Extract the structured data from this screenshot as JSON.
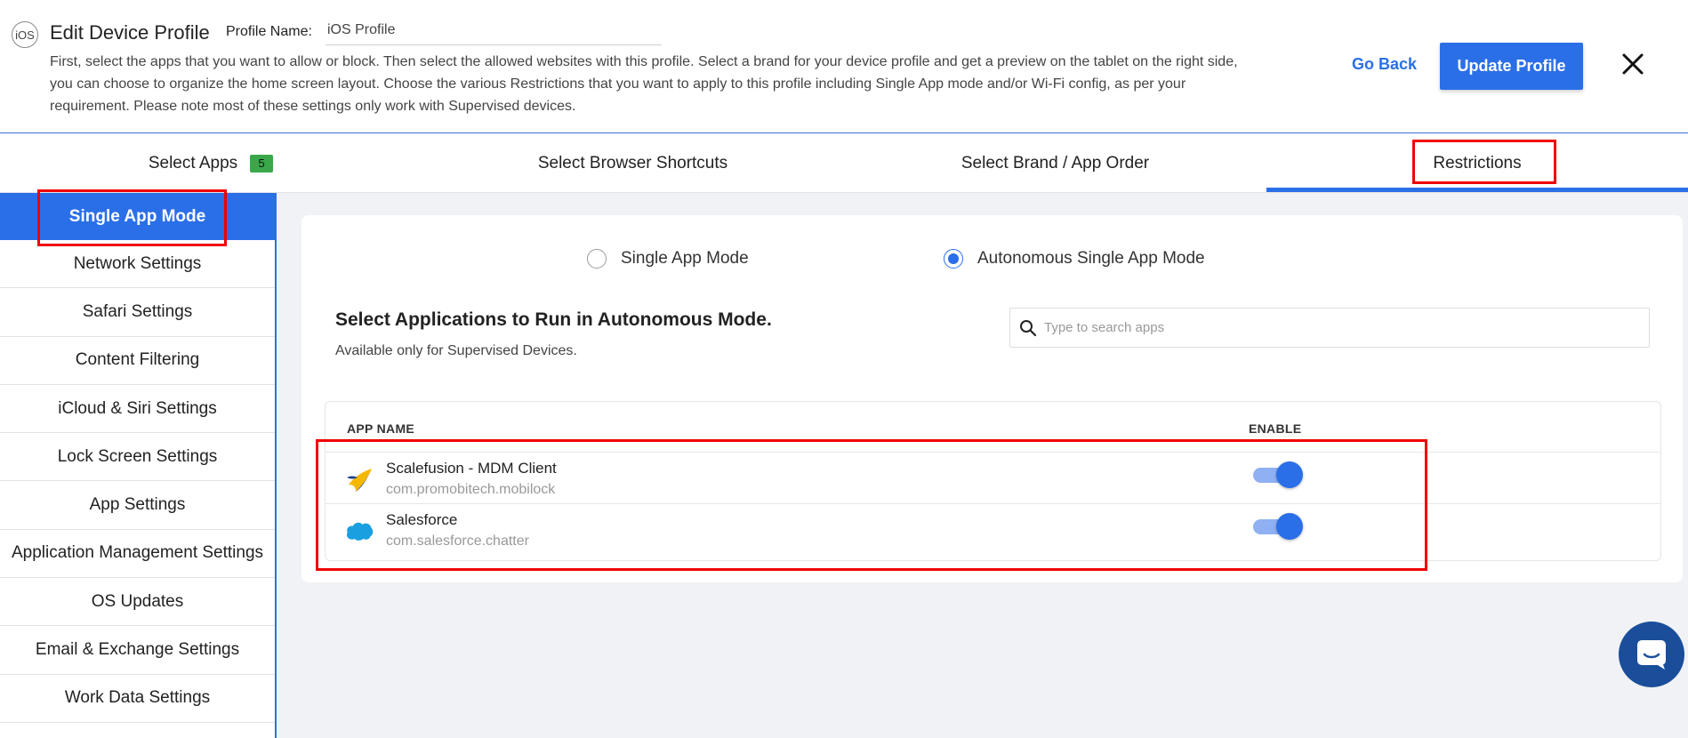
{
  "header": {
    "ios_label": "iOS",
    "title": "Edit Device Profile",
    "profile_name_label": "Profile Name:",
    "profile_name_value": "iOS Profile",
    "description": "First, select the apps that you want to allow or block. Then select the allowed websites with this profile. Select a brand for your device profile and get a preview on the tablet on the right side, you can choose to organize the home screen layout. Choose the various Restrictions that you want to apply to this profile including Single App mode and/or Wi-Fi config, as per your requirement. Please note most of these settings only work with Supervised devices.",
    "go_back": "Go Back",
    "update_profile": "Update Profile"
  },
  "tabs": [
    {
      "label": "Select Apps",
      "badge": "5"
    },
    {
      "label": "Select Browser Shortcuts"
    },
    {
      "label": "Select Brand / App Order"
    },
    {
      "label": "Restrictions",
      "active": true
    }
  ],
  "sidebar": {
    "items": [
      {
        "label": "Single App Mode",
        "active": true
      },
      {
        "label": "Network Settings"
      },
      {
        "label": "Safari Settings"
      },
      {
        "label": "Content Filtering"
      },
      {
        "label": "iCloud & Siri Settings"
      },
      {
        "label": "Lock Screen Settings"
      },
      {
        "label": "App Settings"
      },
      {
        "label": "Application Management Settings"
      },
      {
        "label": "OS Updates"
      },
      {
        "label": "Email & Exchange Settings"
      },
      {
        "label": "Work Data Settings"
      }
    ]
  },
  "mode": {
    "option_single": "Single App Mode",
    "option_autonomous": "Autonomous Single App Mode",
    "selected": "Autonomous Single App Mode"
  },
  "section": {
    "title": "Select Applications to Run in Autonomous Mode.",
    "subtitle": "Available only for Supervised Devices.",
    "search_placeholder": "Type to search apps"
  },
  "table": {
    "col_app_name": "APP NAME",
    "col_enable": "ENABLE",
    "rows": [
      {
        "name": "Scalefusion - MDM Client",
        "package": "com.promobitech.mobilock",
        "enabled": true,
        "icon": "scalefusion-icon"
      },
      {
        "name": "Salesforce",
        "package": "com.salesforce.chatter",
        "enabled": true,
        "icon": "salesforce-cloud-icon"
      }
    ]
  },
  "colors": {
    "primary": "#2b6fe8",
    "highlight": "#ef0000",
    "badge": "#3aa84a",
    "chat": "#1a4e9a"
  }
}
